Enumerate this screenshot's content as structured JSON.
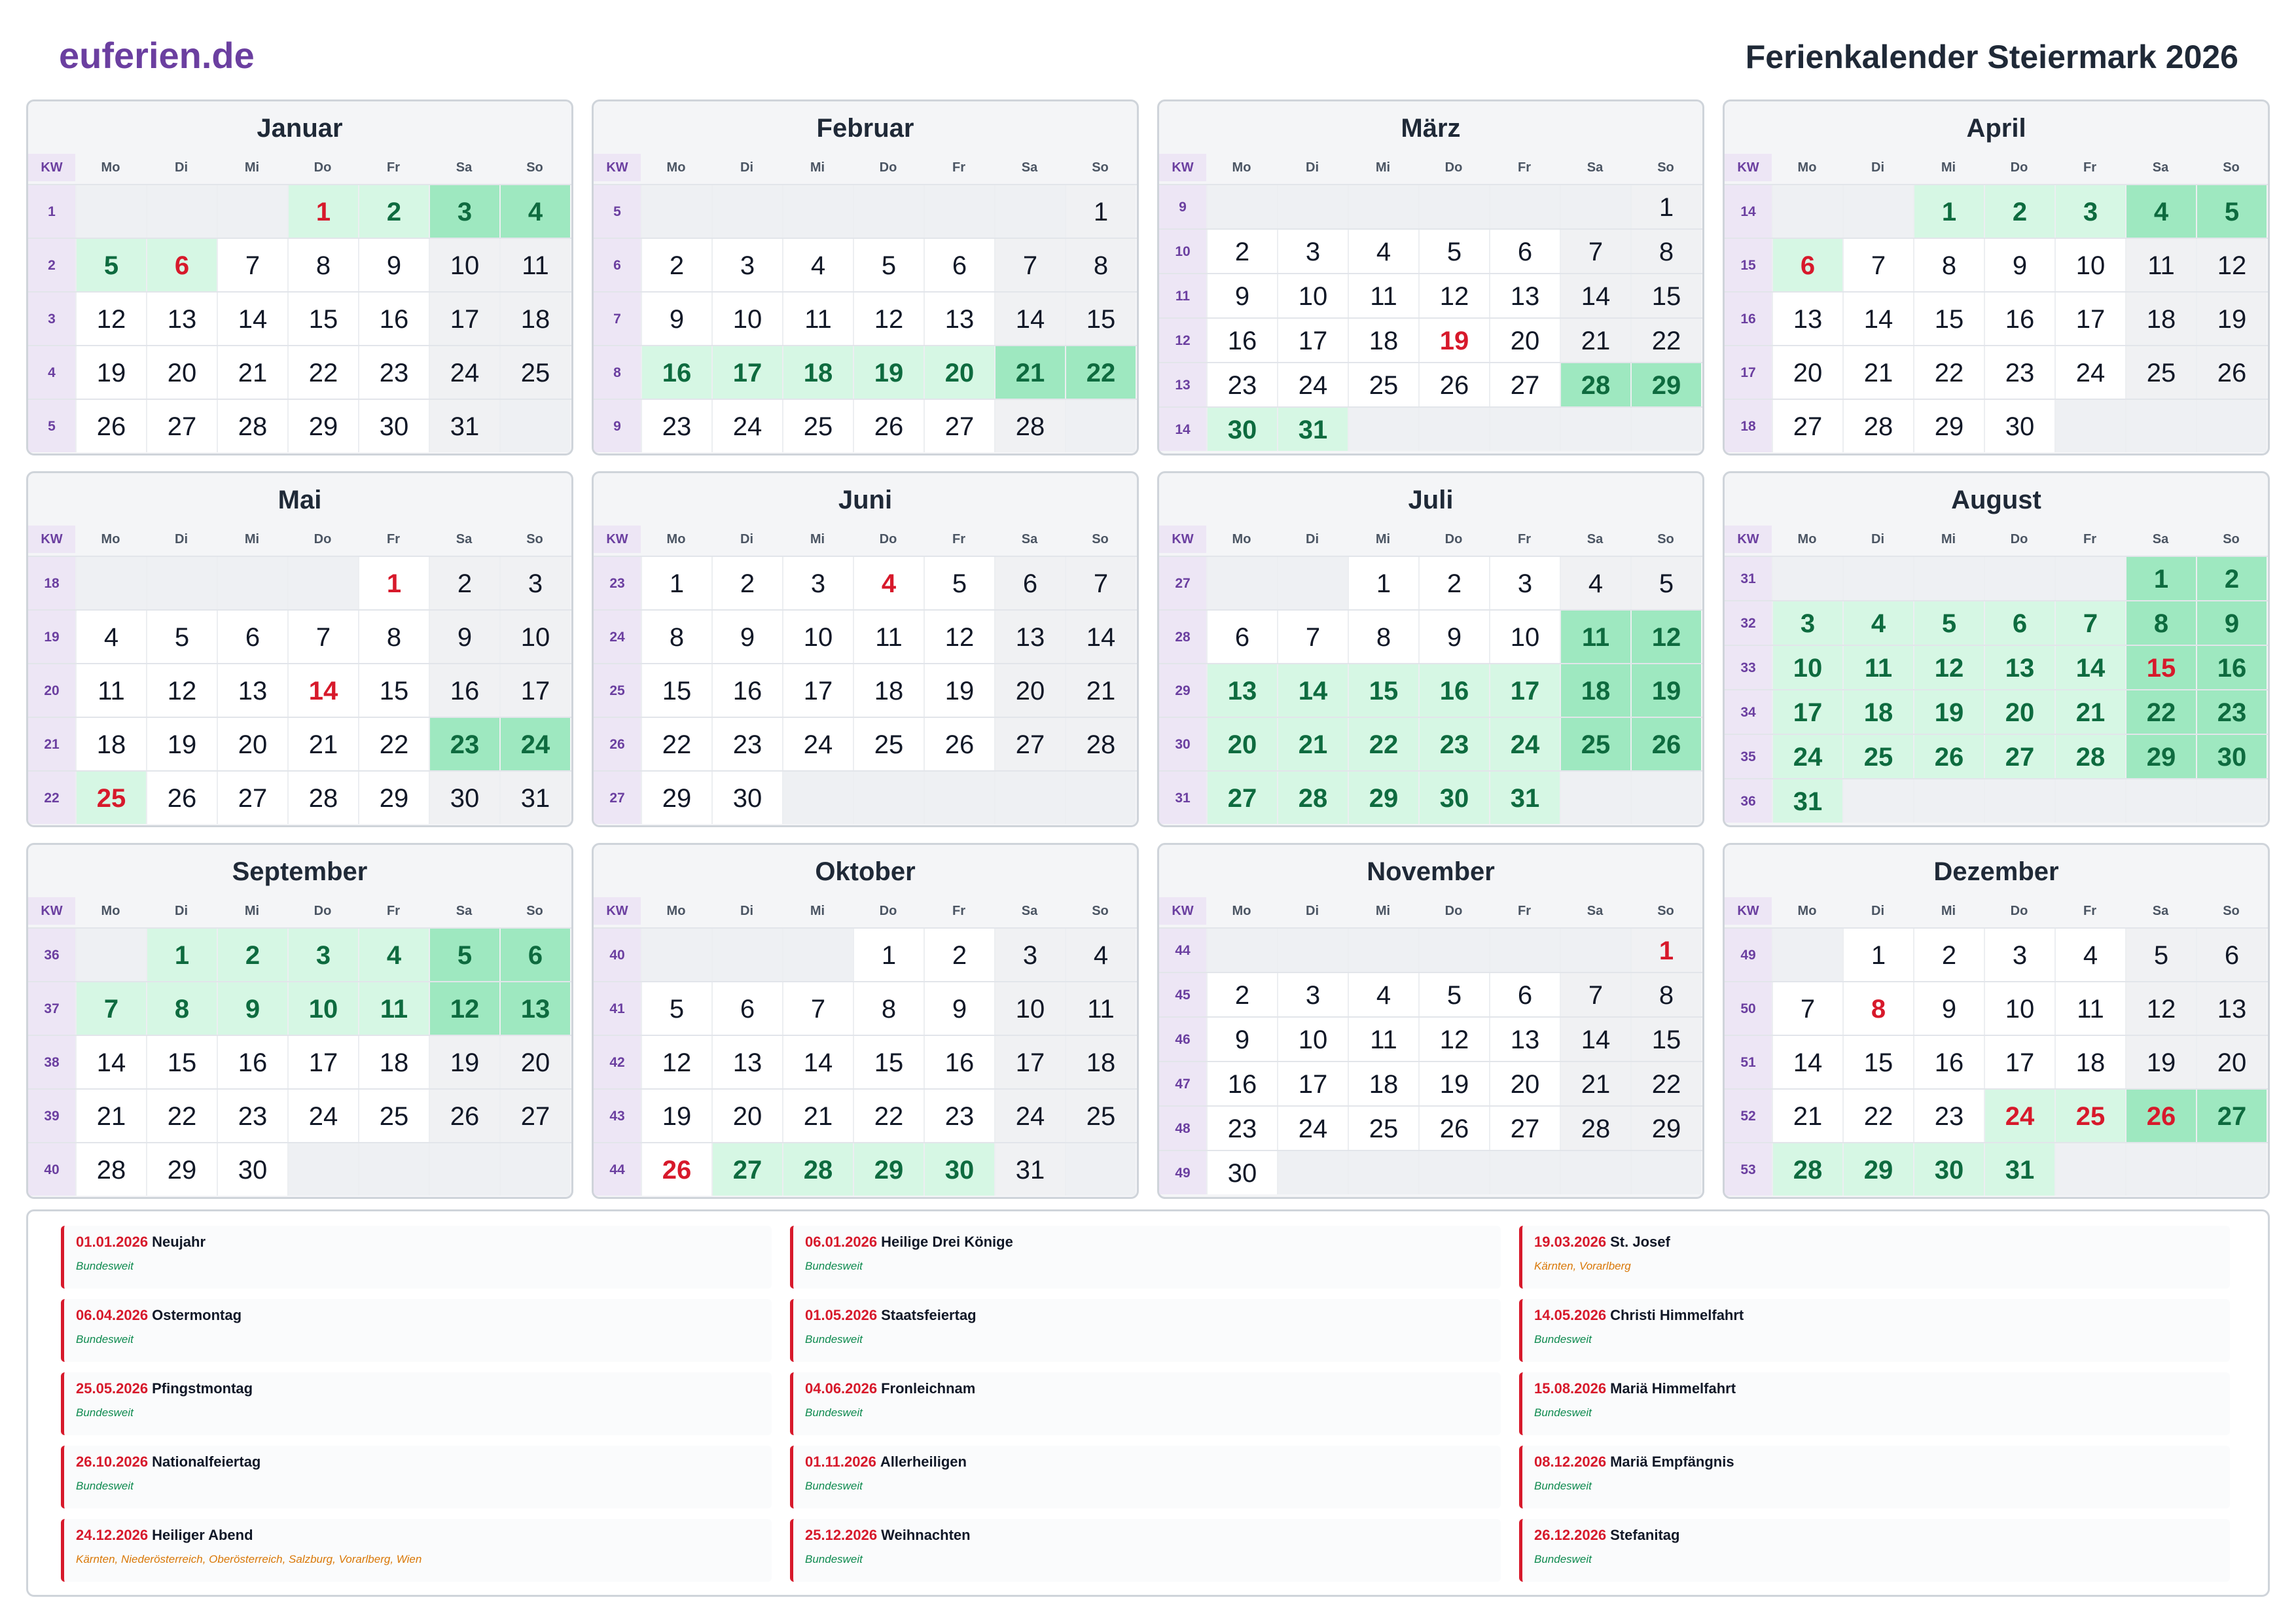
{
  "header": {
    "brand": "euferien.de",
    "title": "Ferienkalender Steiermark 2026"
  },
  "weekday_labels": [
    "KW",
    "Mo",
    "Di",
    "Mi",
    "Do",
    "Fr",
    "Sa",
    "So"
  ],
  "colors": {
    "brand": "#6b3fa0",
    "holiday": "#d7192b",
    "vacation_bg": "#d6f7e4",
    "vacation_weekend_bg": "#9ee8c0",
    "vacation_text": "#0e6b3f",
    "nationwide": "#0e8a4f",
    "regional": "#d97706"
  },
  "months": [
    {
      "name": "Januar",
      "first_weekday": 3,
      "days": 31,
      "kw": [
        1,
        2,
        3,
        4,
        5
      ],
      "holidays": [
        1,
        6
      ],
      "vacation": [
        1,
        2,
        3,
        4,
        5,
        6
      ]
    },
    {
      "name": "Februar",
      "first_weekday": 6,
      "days": 28,
      "kw": [
        5,
        6,
        7,
        8,
        9
      ],
      "holidays": [],
      "vacation": [
        16,
        17,
        18,
        19,
        20,
        21,
        22
      ]
    },
    {
      "name": "März",
      "first_weekday": 6,
      "days": 31,
      "kw": [
        9,
        10,
        11,
        12,
        13,
        14
      ],
      "holidays": [
        19
      ],
      "vacation": [
        28,
        29,
        30,
        31
      ]
    },
    {
      "name": "April",
      "first_weekday": 2,
      "days": 30,
      "kw": [
        14,
        15,
        16,
        17,
        18
      ],
      "holidays": [
        6
      ],
      "vacation": [
        1,
        2,
        3,
        4,
        5,
        6
      ]
    },
    {
      "name": "Mai",
      "first_weekday": 4,
      "days": 31,
      "kw": [
        18,
        19,
        20,
        21,
        22
      ],
      "holidays": [
        1,
        14,
        25
      ],
      "vacation": [
        23,
        24,
        25
      ]
    },
    {
      "name": "Juni",
      "first_weekday": 0,
      "days": 30,
      "kw": [
        23,
        24,
        25,
        26,
        27
      ],
      "holidays": [
        4
      ],
      "vacation": []
    },
    {
      "name": "Juli",
      "first_weekday": 2,
      "days": 31,
      "kw": [
        27,
        28,
        29,
        30,
        31
      ],
      "holidays": [],
      "vacation": [
        11,
        12,
        13,
        14,
        15,
        16,
        17,
        18,
        19,
        20,
        21,
        22,
        23,
        24,
        25,
        26,
        27,
        28,
        29,
        30,
        31
      ]
    },
    {
      "name": "August",
      "first_weekday": 5,
      "days": 31,
      "kw": [
        31,
        32,
        33,
        34,
        35,
        36
      ],
      "holidays": [
        15
      ],
      "vacation": [
        1,
        2,
        3,
        4,
        5,
        6,
        7,
        8,
        9,
        10,
        11,
        12,
        13,
        14,
        15,
        16,
        17,
        18,
        19,
        20,
        21,
        22,
        23,
        24,
        25,
        26,
        27,
        28,
        29,
        30,
        31
      ]
    },
    {
      "name": "September",
      "first_weekday": 1,
      "days": 30,
      "kw": [
        36,
        37,
        38,
        39,
        40
      ],
      "holidays": [],
      "vacation": [
        1,
        2,
        3,
        4,
        5,
        6,
        7,
        8,
        9,
        10,
        11,
        12,
        13
      ]
    },
    {
      "name": "Oktober",
      "first_weekday": 3,
      "days": 31,
      "kw": [
        40,
        41,
        42,
        43,
        44
      ],
      "holidays": [
        26
      ],
      "vacation": [
        27,
        28,
        29,
        30
      ]
    },
    {
      "name": "November",
      "first_weekday": 6,
      "days": 30,
      "kw": [
        44,
        45,
        46,
        47,
        48,
        49
      ],
      "holidays": [
        1
      ],
      "vacation": []
    },
    {
      "name": "Dezember",
      "first_weekday": 1,
      "days": 31,
      "kw": [
        49,
        50,
        51,
        52,
        53
      ],
      "holidays": [
        8,
        24,
        25,
        26
      ],
      "vacation": [
        24,
        25,
        26,
        27,
        28,
        29,
        30,
        31
      ]
    }
  ],
  "holiday_list": [
    {
      "date": "01.01.2026",
      "name": "Neujahr",
      "region": "Bundesweit",
      "nationwide": true
    },
    {
      "date": "06.01.2026",
      "name": "Heilige Drei Könige",
      "region": "Bundesweit",
      "nationwide": true
    },
    {
      "date": "19.03.2026",
      "name": "St. Josef",
      "region": "Kärnten, Vorarlberg",
      "nationwide": false
    },
    {
      "date": "06.04.2026",
      "name": "Ostermontag",
      "region": "Bundesweit",
      "nationwide": true
    },
    {
      "date": "01.05.2026",
      "name": "Staatsfeiertag",
      "region": "Bundesweit",
      "nationwide": true
    },
    {
      "date": "14.05.2026",
      "name": "Christi Himmelfahrt",
      "region": "Bundesweit",
      "nationwide": true
    },
    {
      "date": "25.05.2026",
      "name": "Pfingstmontag",
      "region": "Bundesweit",
      "nationwide": true
    },
    {
      "date": "04.06.2026",
      "name": "Fronleichnam",
      "region": "Bundesweit",
      "nationwide": true
    },
    {
      "date": "15.08.2026",
      "name": "Mariä Himmelfahrt",
      "region": "Bundesweit",
      "nationwide": true
    },
    {
      "date": "26.10.2026",
      "name": "Nationalfeiertag",
      "region": "Bundesweit",
      "nationwide": true
    },
    {
      "date": "01.11.2026",
      "name": "Allerheiligen",
      "region": "Bundesweit",
      "nationwide": true
    },
    {
      "date": "08.12.2026",
      "name": "Mariä Empfängnis",
      "region": "Bundesweit",
      "nationwide": true
    },
    {
      "date": "24.12.2026",
      "name": "Heiliger Abend",
      "region": "Kärnten, Niederösterreich, Oberösterreich, Salzburg, Vorarlberg, Wien",
      "nationwide": false
    },
    {
      "date": "25.12.2026",
      "name": "Weihnachten",
      "region": "Bundesweit",
      "nationwide": true
    },
    {
      "date": "26.12.2026",
      "name": "Stefanitag",
      "region": "Bundesweit",
      "nationwide": true
    }
  ]
}
